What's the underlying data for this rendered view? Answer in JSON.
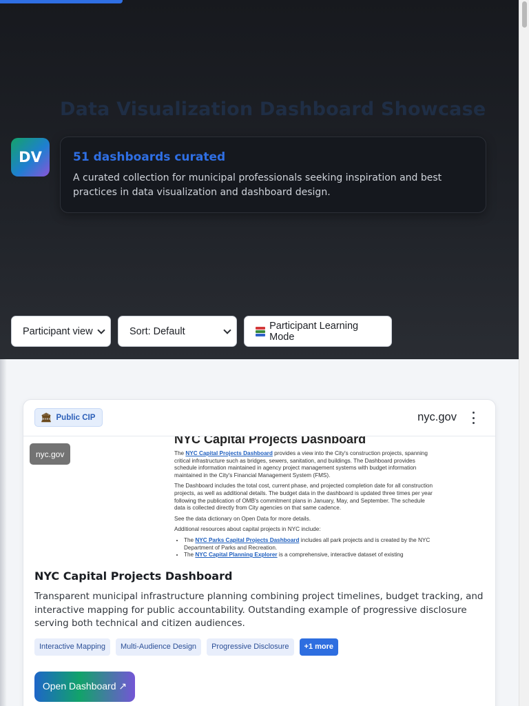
{
  "hero": {
    "title": "Data Visualization Dashboard Showcase",
    "avatar_initials": "DV",
    "count_heading": "51 dashboards curated",
    "description": "A curated collection for municipal professionals seeking inspiration and best practices in data visualization and dashboard design."
  },
  "controls": {
    "view_select": "Participant view",
    "sort_select": "Sort: Default",
    "learning_mode_label": "Participant Learning Mode",
    "learning_mode_icon": "books-icon"
  },
  "card": {
    "badge_label": "Public CIP",
    "badge_icon": "bank-icon",
    "domain": "nyc.gov",
    "preview_tag": "nyc.gov",
    "preview": {
      "heading": "NYC Capital Projects Dashboard",
      "p1_pre": "The ",
      "p1_link": "NYC Capital Projects Dashboard",
      "p1_post": " provides a view into the City's construction projects, spanning critical infrastructure such as bridges, sewers, sanitation, and buildings. The Dashboard provides schedule information maintained in agency project management systems with budget information maintained in the City's Financial Management System (FMS).",
      "p2": "The Dashboard includes the total cost, current phase, and projected completion date for all construction projects, as well as additional details. The budget data in the dashboard is updated three times per year following the publication of OMB's commitment plans in January, May, and September. The schedule data is collected directly from City agencies on that same cadence.",
      "p3": "See the data dictionary on Open Data for more details.",
      "p4": "Additional resources about capital projects in NYC include:",
      "li1_pre": "The ",
      "li1_link": "NYC Parks Capital Projects Dashboard",
      "li1_post": " includes all park projects and is created by the NYC Department of Parks and Recreation.",
      "li2_pre": "The ",
      "li2_link": "NYC Capital Planning Explorer",
      "li2_post": " is a comprehensive, interactive dataset of existing"
    },
    "title": "NYC Capital Projects Dashboard",
    "description": "Transparent municipal infrastructure planning combining project timelines, budget tracking, and interactive mapping for public accountability. Outstanding example of progressive disclosure serving both technical and citizen audiences.",
    "tags": [
      "Interactive Mapping",
      "Multi-Audience Design",
      "Progressive Disclosure"
    ],
    "more_tag": "+1 more",
    "open_button": "Open Dashboard ↗"
  },
  "colors": {
    "accent": "#2f6fe4",
    "hero_bg": "#1c1f24"
  }
}
